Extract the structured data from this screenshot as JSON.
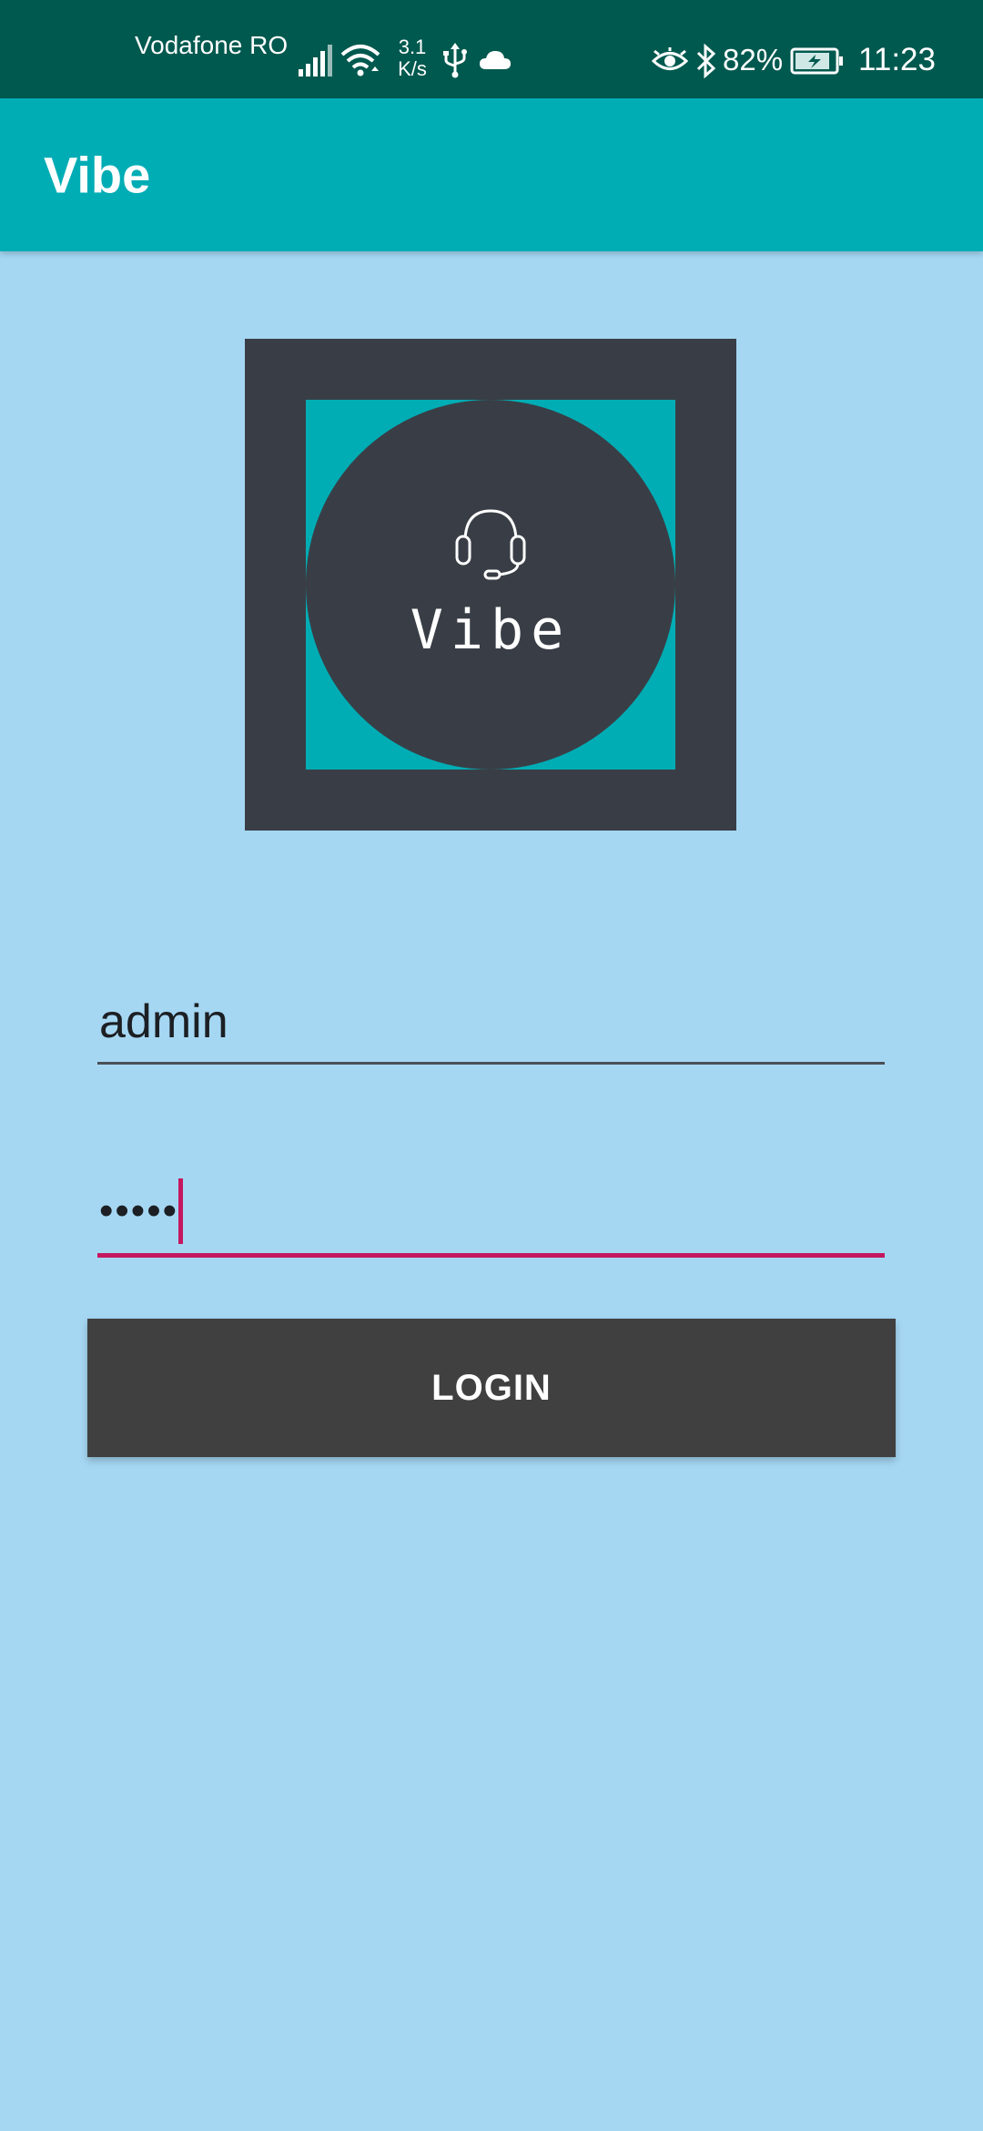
{
  "status_bar": {
    "carrier": "Vodafone RO",
    "net_speed_value": "3.1",
    "net_speed_unit": "K/s",
    "battery_percent": "82%",
    "time": "11:23",
    "icons": [
      "signal-icon",
      "wifi-icon",
      "usb-icon",
      "cloud-icon",
      "eye-icon",
      "bluetooth-icon",
      "battery-icon"
    ]
  },
  "app_bar": {
    "title": "Vibe"
  },
  "logo": {
    "text": "Vibe",
    "icon": "headset-icon",
    "colors": {
      "frame": "#393e46",
      "accent": "#00adb5"
    }
  },
  "login_form": {
    "username_value": "admin",
    "password_value": "•••••",
    "login_label": "LOGIN"
  },
  "colors": {
    "background": "#a5d7f3",
    "status_bar": "#00594f",
    "app_bar": "#00adb5",
    "focus_accent": "#c5175f",
    "button": "#404040"
  }
}
